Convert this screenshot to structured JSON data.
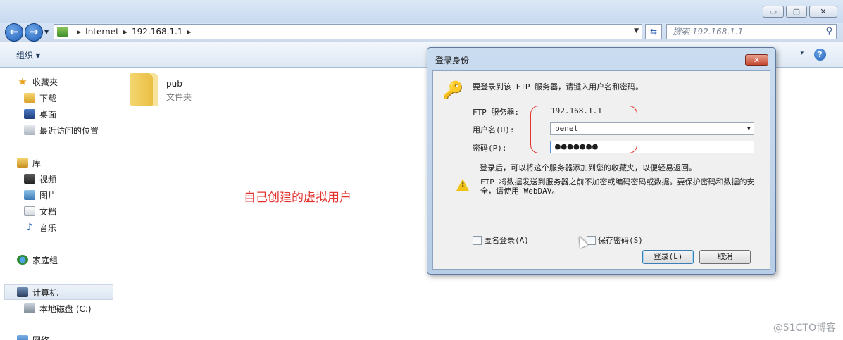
{
  "window": {
    "minimize": "▭",
    "maximize": "▢",
    "close": "✕"
  },
  "address": {
    "segments": [
      "Internet",
      "192.168.1.1"
    ],
    "search_placeholder": "搜索 192.168.1.1"
  },
  "toolbar": {
    "organize": "组织 ▾",
    "view_menu": "▾",
    "help": "?"
  },
  "nav": {
    "favorites": "收藏夹",
    "downloads": "下载",
    "desktop": "桌面",
    "recent": "最近访问的位置",
    "libraries": "库",
    "videos": "视频",
    "pictures": "图片",
    "documents": "文档",
    "music": "音乐",
    "homegroup": "家庭组",
    "computer": "计算机",
    "local_disk": "本地磁盘 (C:)",
    "network": "网络"
  },
  "content": {
    "folder_name": "pub",
    "folder_type": "文件夹",
    "annotation": "自己创建的虚拟用户"
  },
  "dialog": {
    "title": "登录身份",
    "close": "✕",
    "intro": "要登录到该 FTP 服务器，请键入用户名和密码。",
    "server_label": "FTP 服务器:",
    "server_value": "192.168.1.1",
    "username_label": "用户名(U):",
    "username_value": "benet",
    "password_label": "密码(P):",
    "password_value": "●●●●●●●",
    "hint": "登录后，可以将这个服务器添加到您的收藏夹，以便轻易返回。",
    "warning": "FTP 将数据发送到服务器之前不加密或编码密码或数据。要保护密码和数据的安全，请使用 WebDAV。",
    "anonymous_label": "匿名登录(A)",
    "save_password_label": "保存密码(S)",
    "login_button": "登录(L)",
    "cancel_button": "取消"
  },
  "watermark": "@51CTO博客"
}
